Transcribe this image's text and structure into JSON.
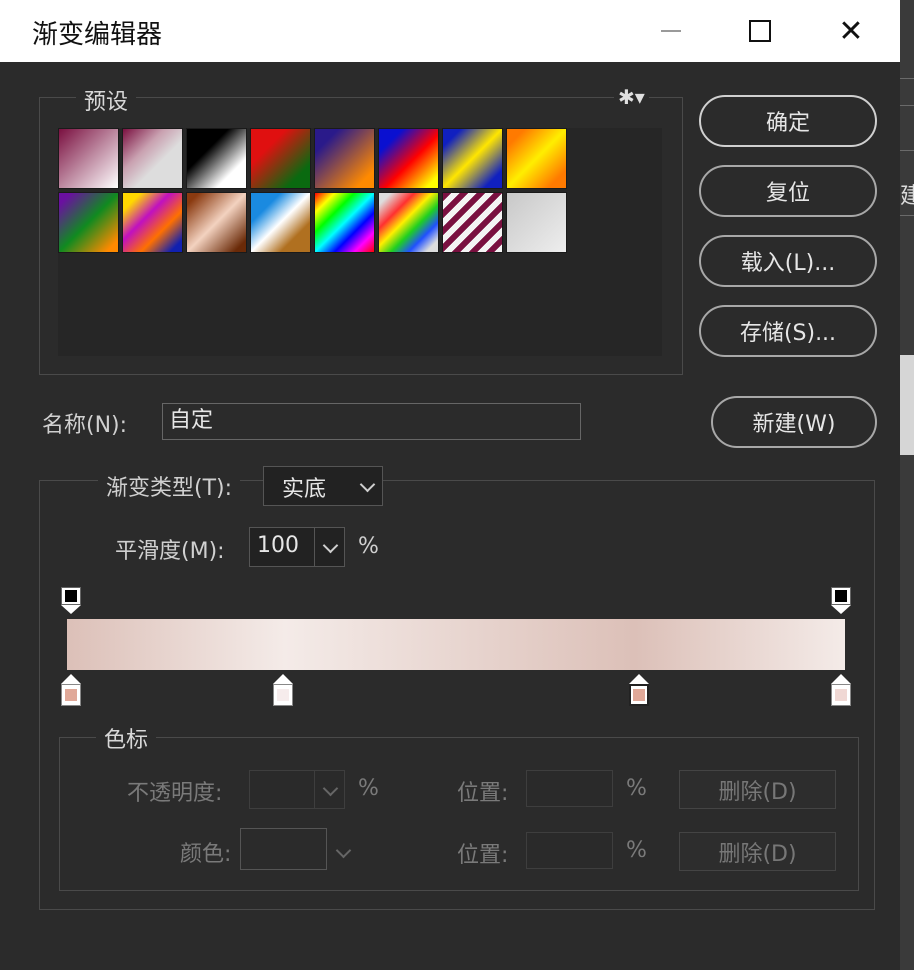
{
  "window": {
    "title": "渐变编辑器",
    "minimize_icon": "minimize-icon",
    "maximize_icon": "maximize-icon",
    "close_icon": "close-icon",
    "close_glyph": "✕"
  },
  "presets": {
    "label": "预设",
    "gear_glyph": "✱▾",
    "swatches": [
      {
        "name": "preset-fg-to-bg",
        "bg": "linear-gradient(135deg,#7a1040,#ffffff)"
      },
      {
        "name": "preset-fg-to-transparent",
        "bg": "linear-gradient(135deg,#7a1040 0%,#c9a0b0 35%,#ddd 60%)"
      },
      {
        "name": "preset-black-white",
        "bg": "linear-gradient(135deg,#000 35%,#fff 75%)"
      },
      {
        "name": "preset-red-green",
        "bg": "linear-gradient(135deg,#e01010 30%,#0a6a10 80%)"
      },
      {
        "name": "preset-violet-orange",
        "bg": "linear-gradient(135deg,#2a1a8a 20%,#ff8a00 85%)"
      },
      {
        "name": "preset-blue-red-yellow",
        "bg": "linear-gradient(135deg,#0a10d0 20%,#ff0000 55%,#ffff00 90%)"
      },
      {
        "name": "preset-blue-yellow-blue",
        "bg": "linear-gradient(135deg,#1020c0 15%,#ffe600 50%,#1020c0 85%)"
      },
      {
        "name": "preset-orange-yellow-orange",
        "bg": "linear-gradient(135deg,#ff7a00 15%,#ffee00 50%,#ff7a00 85%)"
      },
      {
        "name": "preset-violet-green-orange",
        "bg": "linear-gradient(135deg,#6a10a0 10%,#108a20 50%,#ff8a00 90%)"
      },
      {
        "name": "preset-yellow-violet-orange-blue",
        "bg": "linear-gradient(135deg,#ffd800 15%,#c010c0 40%,#ff7000 65%,#1020b0 90%)"
      },
      {
        "name": "preset-copper",
        "bg": "linear-gradient(135deg,#8a3a10 10%,#f3d2c0 50%,#6a2a08 90%)"
      },
      {
        "name": "preset-chrome",
        "bg": "linear-gradient(135deg,#1a8ae0 25%,#ffffff 50%,#b07020 75%)"
      },
      {
        "name": "preset-spectrum",
        "bg": "linear-gradient(135deg,#ff0000,#ffff00,#00ff00,#00ffff,#0000ff,#ff00ff,#ff0000)"
      },
      {
        "name": "preset-transparent-rainbow",
        "bg": "linear-gradient(135deg,#ddd 10%,#ff3030 30%,#ffee00 45%,#20d020 60%,#2050ff 75%,#ddd 90%)"
      },
      {
        "name": "preset-transparent-stripes",
        "bg": "repeating-linear-gradient(135deg,#7a1040 0 6px,#f4f4f4 6px 12px)"
      },
      {
        "name": "preset-fg-transparent-checker",
        "bg": "linear-gradient(135deg,#c8c8c8,#eeeeee)"
      }
    ]
  },
  "buttons": {
    "ok": "确定",
    "reset": "复位",
    "load": "载入(L)...",
    "save": "存储(S)...",
    "new": "新建(W)"
  },
  "name_row": {
    "label": "名称(N):",
    "value": "自定"
  },
  "gradient_type": {
    "label": "渐变类型(T):",
    "value": "实底"
  },
  "smoothness": {
    "label": "平滑度(M):",
    "value": "100",
    "unit": "%"
  },
  "gradient": {
    "colors": [
      "#dcc0b8",
      "#f4ebe8",
      "#dcc0b8",
      "#f4ebe8"
    ],
    "color_stop_positions": [
      0,
      28,
      73,
      100
    ],
    "opacity_stop_positions": [
      0,
      100
    ]
  },
  "color_stops_section": {
    "label": "色标",
    "opacity_label": "不透明度:",
    "opacity_unit": "%",
    "position_label": "位置:",
    "position_unit": "%",
    "delete_label": "删除(D)",
    "color_label": "颜色:",
    "color_position_label": "位置:",
    "color_position_unit": "%",
    "color_delete_label": "删除(D)"
  },
  "background_fragment": "建"
}
